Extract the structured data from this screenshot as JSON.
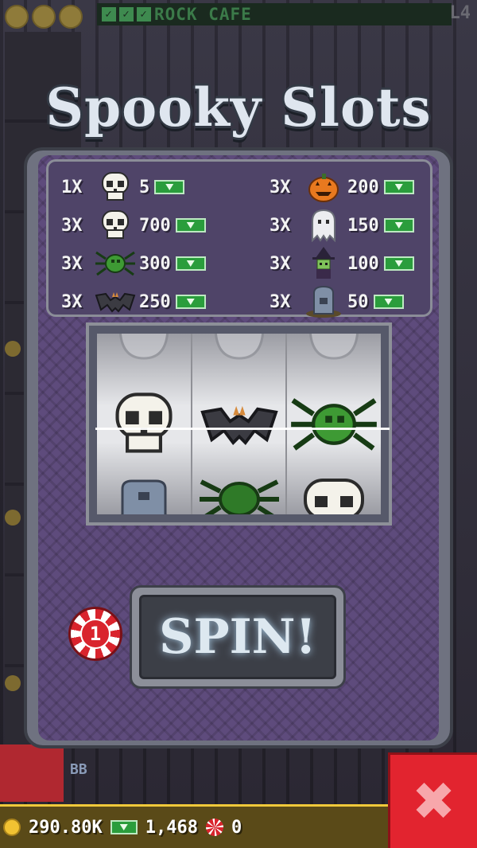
{
  "status_top": {
    "floor_name": "ROCK CAFE",
    "floor_level": "L4"
  },
  "title": "Spooky Slots",
  "paytable": {
    "left": [
      {
        "mult": "1X",
        "icon": "skull",
        "amount": "5"
      },
      {
        "mult": "3X",
        "icon": "skull",
        "amount": "700"
      },
      {
        "mult": "3X",
        "icon": "spider",
        "amount": "300"
      },
      {
        "mult": "3X",
        "icon": "bat",
        "amount": "250"
      }
    ],
    "right": [
      {
        "mult": "3X",
        "icon": "pumpkin",
        "amount": "200"
      },
      {
        "mult": "3X",
        "icon": "ghost",
        "amount": "150"
      },
      {
        "mult": "3X",
        "icon": "witch",
        "amount": "100"
      },
      {
        "mult": "3X",
        "icon": "tombstone",
        "amount": "50"
      }
    ]
  },
  "reels": [
    {
      "top": "ghost",
      "middle": "skull",
      "bottom": "tombstone"
    },
    {
      "top": "ghost",
      "middle": "bat",
      "bottom": "spider"
    },
    {
      "top": "ghost",
      "middle": "spider",
      "bottom": "skull"
    }
  ],
  "bet": {
    "chips": "1"
  },
  "spin_label": "SPIN!",
  "side_label": "BB",
  "bottom_bar": {
    "coins": "290.80K",
    "bux": "1,468",
    "chips": "0"
  },
  "close_icon": "close-icon",
  "colors": {
    "machine_purple": "#5e4b7c",
    "frame_gray": "#6f7280",
    "cash_green": "#2a9d3c",
    "close_red": "#e2242f"
  }
}
